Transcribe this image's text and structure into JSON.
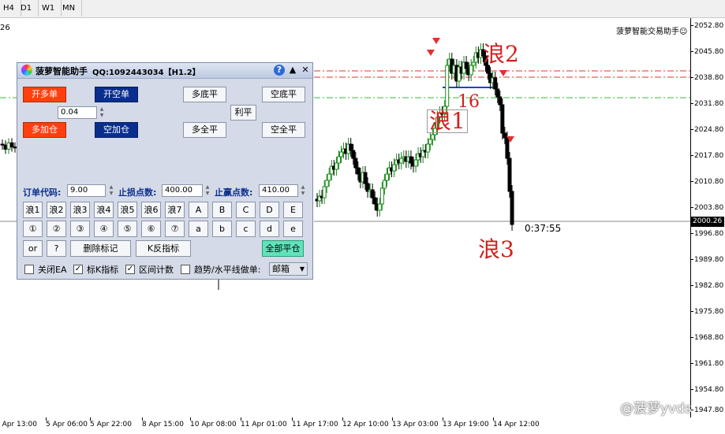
{
  "timeframes": [
    "H4",
    "D1",
    "W1",
    "MN"
  ],
  "symbol_label_fragment": "26",
  "brand_label": "菠萝智能交易助手☺",
  "price_axis": {
    "ticks": [
      "2052.80",
      "2045.80",
      "2038.80",
      "2031.80",
      "2024.80",
      "2017.80",
      "2010.80",
      "2003.80",
      "1996.80",
      "1989.80",
      "1982.80",
      "1975.80",
      "1968.80",
      "1961.80",
      "1954.80",
      "1947.80"
    ],
    "current_price": "2000.26"
  },
  "time_axis": [
    "4 Apr 13:00",
    "5 Apr 06:00",
    "5 Apr 22:00",
    "8 Apr 15:00",
    "10 Apr 08:00",
    "11 Apr 01:00",
    "11 Apr 17:00",
    "12 Apr 10:00",
    "13 Apr 03:00",
    "13 Apr 19:00",
    "14 Apr 12:00"
  ],
  "annotations": {
    "wave1": "浪1",
    "wave2": "浪2",
    "wave3": "浪3",
    "count": "16"
  },
  "countdown": "0:37:55",
  "watermark": "@菠萝yvds",
  "panel": {
    "title": "菠萝智能助手",
    "qq": "QQ:1092443034【H1.2】",
    "help_icon": "?",
    "collapse_icon": "▲",
    "close_icon": "✕",
    "buttons": {
      "open_long": "开多单",
      "open_short": "开空单",
      "add_long": "多加仓",
      "add_short": "空加仓",
      "close_long_partial": "多底平",
      "close_short_partial": "空底平",
      "profit_close": "利平",
      "close_long_all": "多全平",
      "close_short_all": "空全平",
      "delete_marks": "删除标记",
      "k_reverse": "K反指标",
      "close_all": "全部平仓"
    },
    "lot_value": "0.04",
    "order_code_label": "订单代码:",
    "order_code_value": "9.00",
    "stop_loss_label": "止损点数:",
    "stop_loss_value": "400.00",
    "take_profit_label": "止赢点数:",
    "take_profit_value": "410.00",
    "wave_buttons": [
      "浪1",
      "浪2",
      "浪3",
      "浪4",
      "浪5",
      "浪6",
      "浪7",
      "A",
      "B",
      "C",
      "D",
      "E"
    ],
    "circle_buttons": [
      "①",
      "②",
      "③",
      "④",
      "⑤",
      "⑥",
      "⑦",
      "a",
      "b",
      "c",
      "d",
      "e"
    ],
    "or_button": "or",
    "q_button": "?",
    "checkboxes": [
      {
        "label": "关闭EA",
        "checked": false
      },
      {
        "label": "标K指标",
        "checked": true
      },
      {
        "label": "区间计数",
        "checked": true
      },
      {
        "label": "趋势/水平线做单:",
        "checked": false
      }
    ],
    "select_value": "邮箱"
  }
}
